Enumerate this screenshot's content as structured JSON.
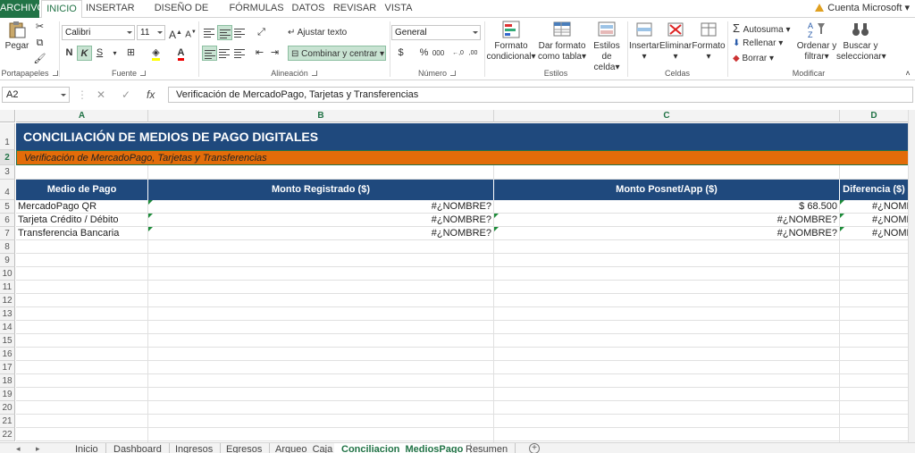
{
  "tabs": {
    "file": "ARCHIVO",
    "items": [
      "INICIO",
      "INSERTAR",
      "DISEÑO DE PÁGINA",
      "FÓRMULAS",
      "DATOS",
      "REVISAR",
      "VISTA"
    ],
    "account": "Cuenta Microsoft"
  },
  "ribbon": {
    "paste": "Pegar",
    "font_name": "Calibri",
    "font_size": "11",
    "bold": "N",
    "italic": "K",
    "underline": "S",
    "wrap_text": "Ajustar texto",
    "merge_center": "Combinar y centrar",
    "number_format": "General",
    "currency": "$",
    "percent": "%",
    "thousands": "000",
    "inc_decimals": "←,0",
    "dec_decimals": ",00",
    "cond_format_1": "Formato",
    "cond_format_2": "condicional",
    "format_table_1": "Dar formato",
    "format_table_2": "como tabla",
    "cell_styles_1": "Estilos de",
    "cell_styles_2": "celda",
    "insert": "Insertar",
    "delete": "Eliminar",
    "format": "Formato",
    "autosum": "Autosuma",
    "fill": "Rellenar",
    "clear": "Borrar",
    "sort_1": "Ordenar y",
    "sort_2": "filtrar",
    "find_1": "Buscar y",
    "find_2": "seleccionar",
    "groups": {
      "clipboard": "Portapapeles",
      "font": "Fuente",
      "alignment": "Alineación",
      "number": "Número",
      "styles": "Estilos",
      "cells": "Celdas",
      "editing": "Modificar"
    }
  },
  "formula_bar": {
    "name_box": "A2",
    "cancel": "✕",
    "enter": "✓",
    "fx": "fx",
    "content": "Verificación de MercadoPago, Tarjetas y Transferencias"
  },
  "columns": [
    "A",
    "B",
    "C",
    "D"
  ],
  "rows": [
    "1",
    "2",
    "3",
    "4",
    "5",
    "6",
    "7",
    "8",
    "9",
    "10",
    "11",
    "12",
    "13",
    "14",
    "15",
    "16",
    "17",
    "18",
    "19",
    "20",
    "21",
    "22"
  ],
  "sheet": {
    "title": "CONCILIACIÓN DE MEDIOS DE PAGO DIGITALES",
    "subtitle": "Verificación de MercadoPago, Tarjetas y Transferencias",
    "headers": [
      "Medio de Pago",
      "Monto Registrado ($)",
      "Monto Posnet/App ($)",
      "Diferencia ($)"
    ],
    "data_rows": [
      {
        "medio": "MercadoPago QR",
        "registrado": "#¿NOMBRE?",
        "posnet": "$ 68.500",
        "diferencia": "#¿NOMBRE?"
      },
      {
        "medio": "Tarjeta Crédito / Débito",
        "registrado": "#¿NOMBRE?",
        "posnet": "#¿NOMBRE?",
        "diferencia": "#¿NOMBRE?"
      },
      {
        "medio": "Transferencia Bancaria",
        "registrado": "#¿NOMBRE?",
        "posnet": "#¿NOMBRE?",
        "diferencia": "#¿NOMBRE?"
      }
    ]
  },
  "sheet_tabs": {
    "items": [
      "Inicio",
      "Dashboard",
      "Ingresos",
      "Egresos",
      "Arqueo_Caja",
      "Conciliacion_MediosPago",
      "Resumen"
    ],
    "active": "Conciliacion_MediosPago",
    "add": "+"
  },
  "colors": {
    "excel_green": "#217346",
    "title_fill": "#1f497d",
    "subtitle_fill": "#e36c09",
    "error_indicator": "#1e8c3a"
  }
}
